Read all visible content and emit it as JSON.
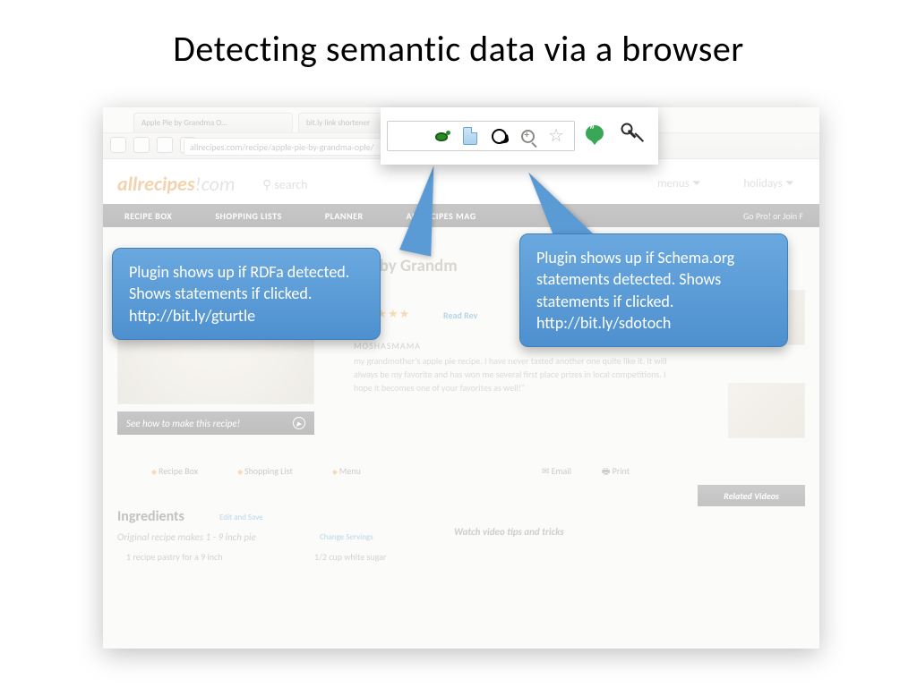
{
  "title": "Detecting semantic data via a browser",
  "callouts": {
    "left": "Plugin shows up if RDFa detected. Shows statements if clicked. http://bit.ly/gturtle",
    "right": "Plugin shows up if Schema.org statements detected. Shows statements if clicked. http://bit.ly/sdotoch"
  },
  "browser": {
    "tab1": "Apple Pie by Grandma O…",
    "tab2": "bit.ly link shortener",
    "url": "allrecipes.com/recipe/apple-pie-by-grandma-ople/"
  },
  "site": {
    "logo_main": "allrecipes",
    "logo_suffix": "!com",
    "search": "⚲ search",
    "menus": "menus ⏷",
    "holidays": "holidays ⏷"
  },
  "nav": {
    "item1": "RECIPE BOX",
    "item2": "SHOPPING LISTS",
    "item3": "PLANNER",
    "item4": "ALLRECIPES MAG",
    "right": "Go Pro!   or   Join F"
  },
  "recipe": {
    "title": "Pie by Grandm",
    "stars": "★★★★★",
    "reviews": "Read Rev",
    "byline": "MOSHASMAMA",
    "desc": "my grandmother's apple pie recipe. I have never tasted another one quite like it. It will always be my favorite and has won me several first place prizes in local competitions. I hope it becomes one of your favorites as well!\"",
    "see_how": "See how to make this recipe!"
  },
  "actions": {
    "a1": "Recipe Box",
    "a2": "Shopping List",
    "a3": "Menu",
    "email": "✉  Email",
    "print": "🖶  Print"
  },
  "ingredients": {
    "head": "Ingredients",
    "edit": "Edit and Save",
    "sub": "Original recipe makes 1 - 9 inch pie",
    "change": "Change Servings",
    "line1": "1 recipe pastry for a 9 inch",
    "line2": "1/2 cup white sugar"
  },
  "sidebar": {
    "related": "Related Videos",
    "watch": "Watch video tips and tricks"
  }
}
